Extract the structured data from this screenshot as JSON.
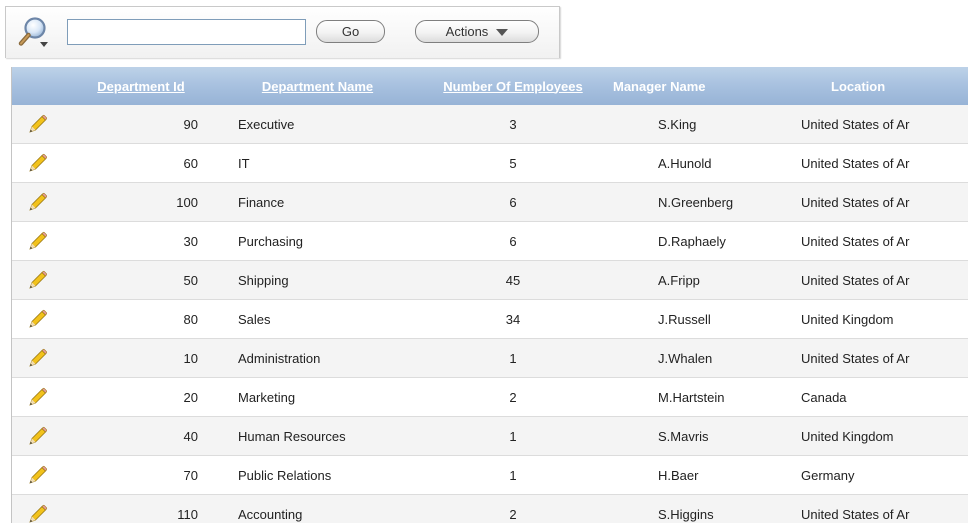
{
  "toolbar": {
    "search_icon": "search-icon",
    "search_value": "",
    "go_label": "Go",
    "actions_label": "Actions",
    "actions_icon": "chevron-down-icon"
  },
  "report": {
    "headers": {
      "edit": "",
      "department_id": "Department Id",
      "department_name": "Department Name",
      "number_of_employees": "Number Of Employees",
      "manager_name": "Manager Name",
      "location": "Location"
    },
    "edit_icon": "pencil-icon",
    "rows": [
      {
        "department_id": "90",
        "department_name": "Executive",
        "number_of_employees": "3",
        "manager_name": "S.King",
        "location": "United States of Ar"
      },
      {
        "department_id": "60",
        "department_name": "IT",
        "number_of_employees": "5",
        "manager_name": "A.Hunold",
        "location": "United States of Ar"
      },
      {
        "department_id": "100",
        "department_name": "Finance",
        "number_of_employees": "6",
        "manager_name": "N.Greenberg",
        "location": "United States of Ar"
      },
      {
        "department_id": "30",
        "department_name": "Purchasing",
        "number_of_employees": "6",
        "manager_name": "D.Raphaely",
        "location": "United States of Ar"
      },
      {
        "department_id": "50",
        "department_name": "Shipping",
        "number_of_employees": "45",
        "manager_name": "A.Fripp",
        "location": "United States of Ar"
      },
      {
        "department_id": "80",
        "department_name": "Sales",
        "number_of_employees": "34",
        "manager_name": "J.Russell",
        "location": "United Kingdom"
      },
      {
        "department_id": "10",
        "department_name": "Administration",
        "number_of_employees": "1",
        "manager_name": "J.Whalen",
        "location": "United States of Ar"
      },
      {
        "department_id": "20",
        "department_name": "Marketing",
        "number_of_employees": "2",
        "manager_name": "M.Hartstein",
        "location": "Canada"
      },
      {
        "department_id": "40",
        "department_name": "Human Resources",
        "number_of_employees": "1",
        "manager_name": "S.Mavris",
        "location": "United Kingdom"
      },
      {
        "department_id": "70",
        "department_name": "Public Relations",
        "number_of_employees": "1",
        "manager_name": "H.Baer",
        "location": "Germany"
      },
      {
        "department_id": "110",
        "department_name": "Accounting",
        "number_of_employees": "2",
        "manager_name": "S.Higgins",
        "location": "United States of Ar"
      }
    ]
  }
}
